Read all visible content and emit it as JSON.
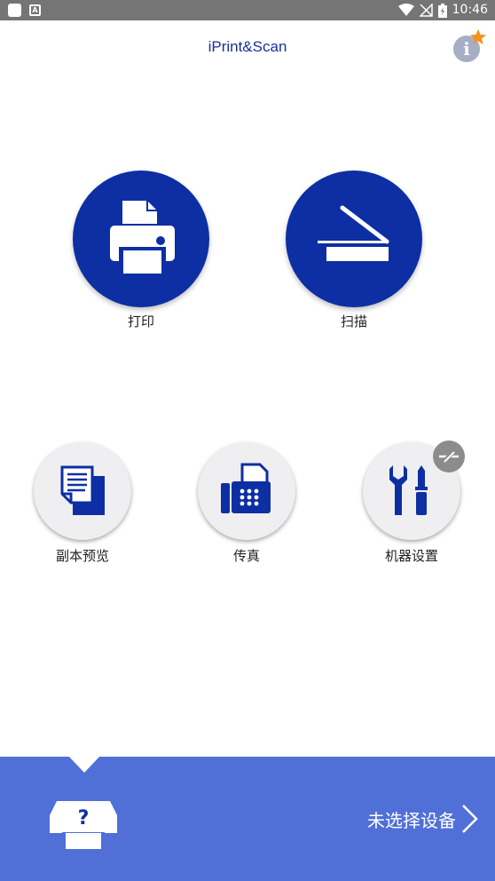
{
  "status_bar": {
    "time": "10:46",
    "icons": [
      "app-notification-icon",
      "font-notification-icon",
      "wifi-icon",
      "no-signal-icon",
      "battery-icon"
    ]
  },
  "header": {
    "title": "iPrint&Scan",
    "info_icon": "info-icon",
    "badge_icon": "star-icon"
  },
  "main_functions": [
    {
      "label": "打印",
      "icon": "printer-icon"
    },
    {
      "label": "扫描",
      "icon": "scanner-icon"
    }
  ],
  "secondary_functions": [
    {
      "label": "副本预览",
      "icon": "copy-preview-icon"
    },
    {
      "label": "传真",
      "icon": "fax-icon"
    },
    {
      "label": "机器设置",
      "icon": "tools-icon",
      "status_badge": "offline-icon"
    }
  ],
  "device_panel": {
    "label": "未选择设备",
    "icon": "unknown-printer-icon",
    "device_icon_glyph": "?",
    "chevron": "chevron-right-icon"
  },
  "colors": {
    "primary": "#0d2fa3",
    "title": "#1a2f9a",
    "panel": "#5070d8",
    "star": "#f5921e",
    "status_bar": "#757575"
  }
}
